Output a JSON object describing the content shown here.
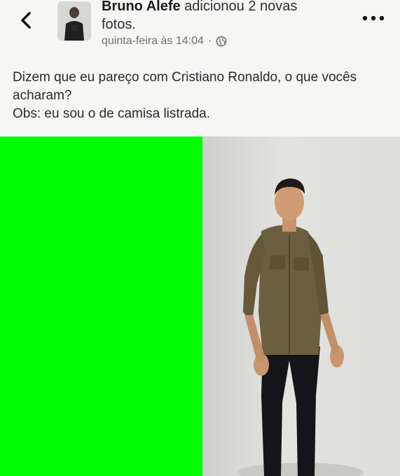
{
  "post": {
    "author": "Bruno Alefe",
    "action": " adicionou 2 novas fotos.",
    "timestamp": "quinta-feira às 14:04",
    "separator": "·",
    "text_line1": "Dizem que eu pareço com Cristiano Ronaldo, o que vocês acharam?",
    "text_line2": "Obs: eu sou o de camisa listrada."
  },
  "icons": {
    "back": "chevron-left-icon",
    "more": "more-horizontal-icon",
    "audience": "globe-icon"
  },
  "colors": {
    "left_photo": "#00ff00",
    "background": "#f6f6f4",
    "author_text": "#1c1c1c",
    "meta_text": "#6f6f6f"
  }
}
